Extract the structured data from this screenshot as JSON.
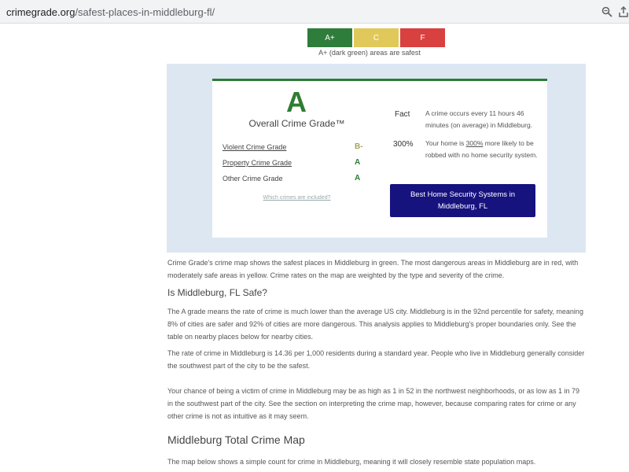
{
  "browser": {
    "url_domain": "crimegrade.org",
    "url_path": "/safest-places-in-middleburg-fl/"
  },
  "legend": {
    "grades": [
      {
        "label": "A+",
        "color": "#2e7d3a"
      },
      {
        "label": "C",
        "color": "#e1c85a"
      },
      {
        "label": "F",
        "color": "#d94040"
      }
    ],
    "caption": "A+ (dark green) areas are safest"
  },
  "grade_card": {
    "grade": "A",
    "title": "Overall Crime Grade™",
    "categories": [
      {
        "label": "Violent Crime Grade",
        "grade": "B-",
        "grade_color": "#a5a35a"
      },
      {
        "label": "Property Crime Grade",
        "grade": "A",
        "grade_color": "#2e7d32"
      },
      {
        "label": "Other Crime Grade",
        "grade": "A",
        "grade_color": "#2e7d32"
      }
    ],
    "which_link": "Which crimes are included?",
    "facts": [
      {
        "key": "Fact",
        "text": "A crime occurs every 11 hours 46 minutes (on average) in Middleburg."
      },
      {
        "key": "300%",
        "text_before": "Your home is ",
        "highlight": "300%",
        "text_after": " more likely to be robbed with no home security system."
      }
    ],
    "security_button": "Best Home Security Systems in Middleburg, FL"
  },
  "content": {
    "intro": "Crime Grade's crime map shows the safest places in Middleburg in green. The most dangerous areas in Middleburg are in red, with moderately safe areas in yellow. Crime rates on the map are weighted by the type and severity of the crime.",
    "safe_heading": "Is Middleburg, FL Safe?",
    "para1": "The A grade means the rate of crime is much lower than the average US city. Middleburg is in the 92nd percentile for safety, meaning 8% of cities are safer and 92% of cities are more dangerous. This analysis applies to Middleburg's proper boundaries only. See the table on nearby places below for nearby cities.",
    "para2": "The rate of crime in Middleburg is 14.36 per 1,000 residents during a standard year. People who live in Middleburg generally consider the southwest part of the city to be the safest.",
    "para3": "Your chance of being a victim of crime in Middleburg may be as high as 1 in 52 in the northwest neighborhoods, or as low as 1 in 79 in the southwest part of the city. See the section on interpreting the crime map, however, because comparing rates for crime or any other crime is not as intuitive as it may seem.",
    "map_heading": "Middleburg Total Crime Map",
    "para4": "The map below shows a simple count for crime in Middleburg, meaning it will closely resemble state population maps."
  },
  "icons": {
    "zoom": "zoom-icon",
    "share": "share-icon"
  }
}
